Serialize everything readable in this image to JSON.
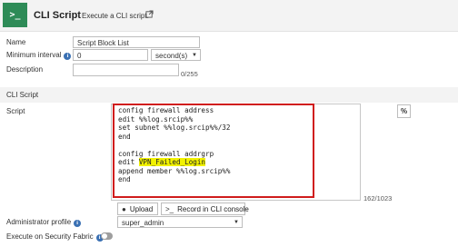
{
  "header": {
    "icon_text": ">_",
    "title": "CLI Script",
    "subtitle": "Execute a CLI script.",
    "external_icon": "external-link-icon"
  },
  "form": {
    "name": {
      "label": "Name",
      "value": "Script Block List"
    },
    "minimum_interval": {
      "label": "Minimum interval",
      "value": "0",
      "unit": "second(s)"
    },
    "description": {
      "label": "Description",
      "value": "",
      "counter": "0/255"
    },
    "section_cli": "CLI Script",
    "script": {
      "label": "Script",
      "lines": [
        "config firewall address",
        "edit %%log.srcip%%",
        "set subnet %%log.srcip%%/32",
        "end",
        "",
        "config firewall addrgrp",
        "edit ",
        "append member %%log.srcip%%",
        "end"
      ],
      "highlight_text": "VPN_Failed_Login",
      "counter": "162/1023",
      "percent_button": "%"
    },
    "buttons": {
      "upload": "Upload",
      "record": "Record in CLI console"
    },
    "admin_profile": {
      "label": "Administrator profile",
      "value": "super_admin"
    },
    "security_fabric": {
      "label": "Execute on Security Fabric",
      "enabled": false
    }
  },
  "colors": {
    "header_icon": "#2e8b57",
    "highlight_border": "#d01c1c",
    "highlight_text_bg": "#f2f200",
    "info_icon": "#3a70b3"
  }
}
